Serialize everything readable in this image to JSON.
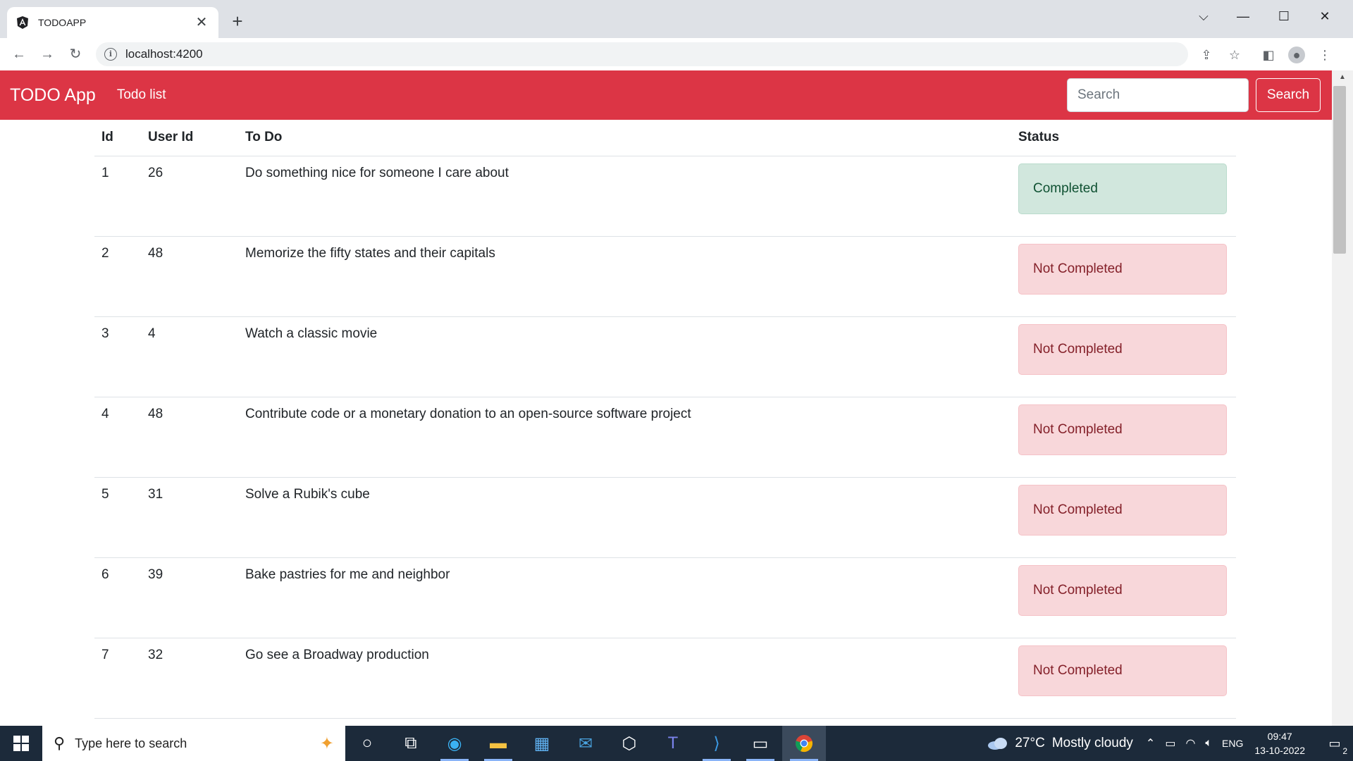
{
  "browser": {
    "tab_title": "TODOAPP",
    "tab_close": "✕",
    "new_tab": "+",
    "url": "localhost:4200",
    "window_controls": {
      "dropdown": "⌵",
      "minimize": "—",
      "maximize": "☐",
      "close": "✕"
    }
  },
  "app": {
    "brand": "TODO App",
    "nav_link": "Todo list",
    "search_placeholder": "Search",
    "search_button": "Search"
  },
  "table": {
    "headers": {
      "id": "Id",
      "user_id": "User Id",
      "todo": "To Do",
      "status": "Status"
    },
    "rows": [
      {
        "id": "1",
        "user_id": "26",
        "todo": "Do something nice for someone I care about",
        "status": "Completed",
        "completed": true
      },
      {
        "id": "2",
        "user_id": "48",
        "todo": "Memorize the fifty states and their capitals",
        "status": "Not Completed",
        "completed": false
      },
      {
        "id": "3",
        "user_id": "4",
        "todo": "Watch a classic movie",
        "status": "Not Completed",
        "completed": false
      },
      {
        "id": "4",
        "user_id": "48",
        "todo": "Contribute code or a monetary donation to an open-source software project",
        "status": "Not Completed",
        "completed": false
      },
      {
        "id": "5",
        "user_id": "31",
        "todo": "Solve a Rubik's cube",
        "status": "Not Completed",
        "completed": false
      },
      {
        "id": "6",
        "user_id": "39",
        "todo": "Bake pastries for me and neighbor",
        "status": "Not Completed",
        "completed": false
      },
      {
        "id": "7",
        "user_id": "32",
        "todo": "Go see a Broadway production",
        "status": "Not Completed",
        "completed": false
      }
    ]
  },
  "taskbar": {
    "search_placeholder": "Type here to search",
    "weather_temp": "27°C",
    "weather_text": "Mostly cloudy",
    "language": "ENG",
    "time": "09:47",
    "date": "13-10-2022",
    "notification_count": "2"
  },
  "colors": {
    "navbar": "#dc3545",
    "completed_bg": "#d1e7dd",
    "not_completed_bg": "#f8d7da",
    "taskbar": "#1c2a3a"
  }
}
